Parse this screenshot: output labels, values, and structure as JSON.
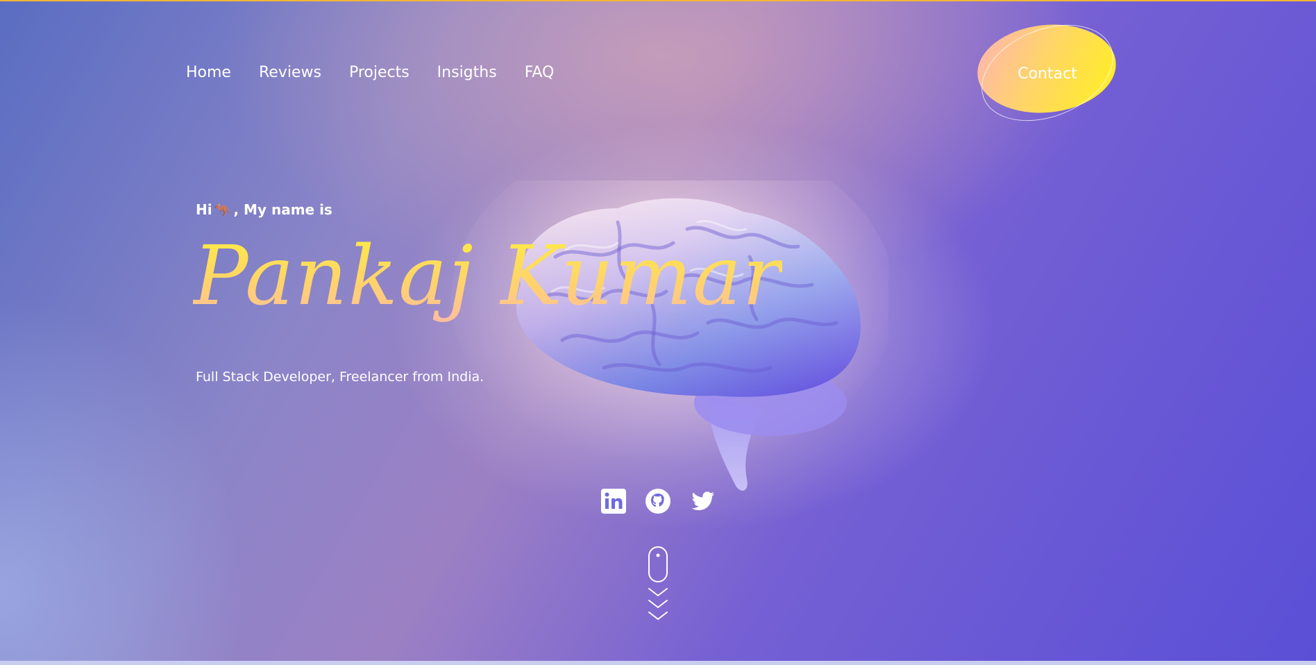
{
  "nav": {
    "items": [
      {
        "label": "Home"
      },
      {
        "label": "Reviews"
      },
      {
        "label": "Projects"
      },
      {
        "label": "Insigths"
      },
      {
        "label": "FAQ"
      }
    ]
  },
  "contact": {
    "label": "Contact"
  },
  "hero": {
    "greeting_prefix": "Hi",
    "greeting_emoji": "🦘",
    "greeting_suffix": ", My name is",
    "name": "Pankaj Kumar",
    "tagline": "Full Stack Developer, Freelancer from India."
  },
  "social": {
    "icons": [
      "linkedin-icon",
      "github-icon",
      "twitter-icon"
    ]
  },
  "colors": {
    "accent_yellow": "#fff13a",
    "accent_pink": "#ffb2b8",
    "top_line": "#f2b636",
    "background_purple": "#5a4fd6"
  }
}
